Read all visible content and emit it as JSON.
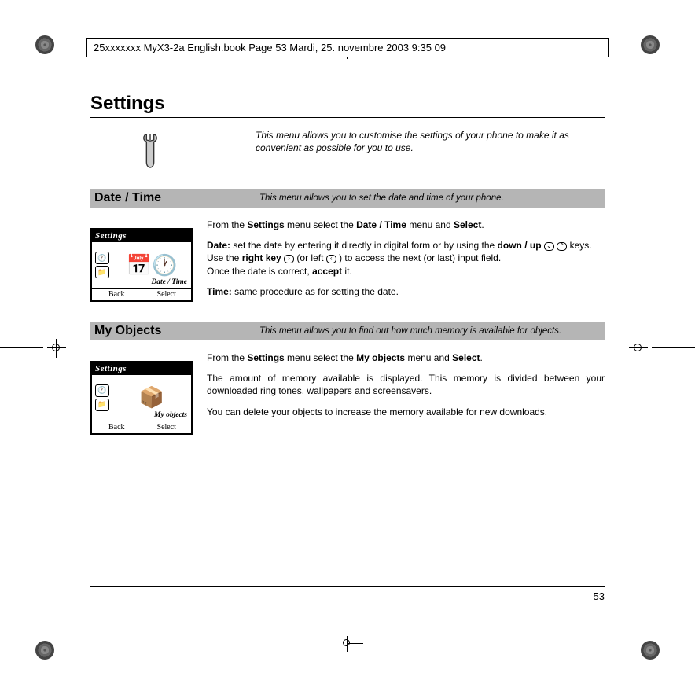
{
  "header_line": "25xxxxxxx MyX3-2a English.book  Page 53  Mardi, 25. novembre 2003  9:35 09",
  "page_title": "Settings",
  "page_number": "53",
  "intro_text": "This menu allows you to customise the settings of your phone to make it as convenient as possible for you to use.",
  "sections": [
    {
      "title": "Date / Time",
      "desc": "This menu allows you to set the date and time of your phone.",
      "screen": {
        "header": "Settings",
        "label": "Date / Time",
        "left_btn": "Back",
        "right_btn": "Select"
      },
      "body": {
        "p1_pre": "From the ",
        "p1_b1": "Settings",
        "p1_mid1": " menu select the ",
        "p1_b2": "Date / Time",
        "p1_mid2": " menu and ",
        "p1_b3": "Select",
        "p1_end": ".",
        "p2_label": "Date:",
        "p2_text1": " set the date by entering it directly in digital form or by using the ",
        "p2_b1": "down / up",
        "p2_mid1": "  keys.",
        "p2_line2a": "Use the ",
        "p2_b2": "right key",
        "p2_line2b": "  (or left  ) to access the next (or last) input field.",
        "p2_line3a": "Once the date is correct, ",
        "p2_b3": "accept",
        "p2_line3b": " it.",
        "p3_label": "Time:",
        "p3_text": " same procedure as for setting the date."
      }
    },
    {
      "title": "My Objects",
      "desc": "This menu allows you to find out how much memory is available for objects.",
      "screen": {
        "header": "Settings",
        "label": "My objects",
        "left_btn": "Back",
        "right_btn": "Select"
      },
      "body": {
        "p1_pre": "From the ",
        "p1_b1": "Settings",
        "p1_mid1": " menu select the ",
        "p1_b2": "My objects",
        "p1_mid2": " menu and ",
        "p1_b3": "Select",
        "p1_end": ".",
        "p2": "The amount of memory available is displayed. This memory is divided between your downloaded ring tones, wallpapers and screensavers.",
        "p3": "You can delete your objects to increase the memory available for new downloads."
      }
    }
  ]
}
